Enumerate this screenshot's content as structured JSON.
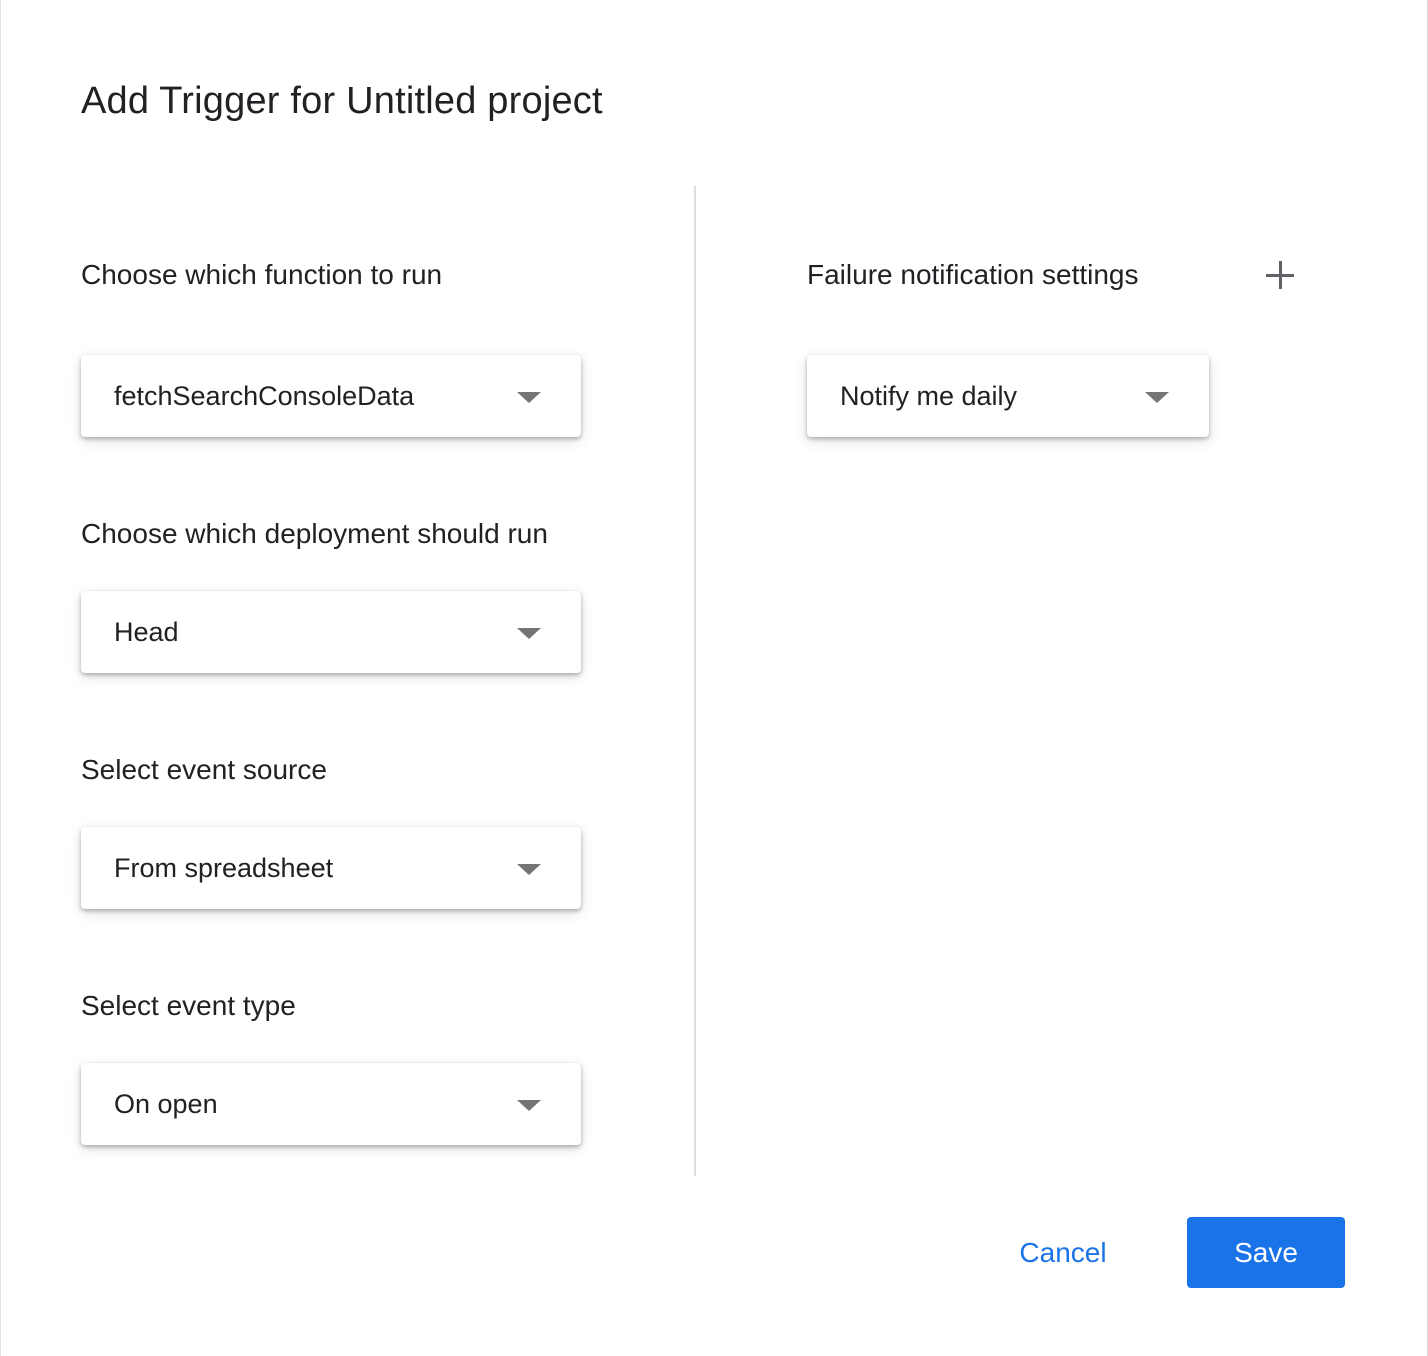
{
  "dialog": {
    "title": "Add Trigger for Untitled project"
  },
  "left_panel": {
    "function": {
      "label": "Choose which function to run",
      "selected": "fetchSearchConsoleData"
    },
    "deployment": {
      "label": "Choose which deployment should run",
      "selected": "Head"
    },
    "event_source": {
      "label": "Select event source",
      "selected": "From spreadsheet"
    },
    "event_type": {
      "label": "Select event type",
      "selected": "On open"
    }
  },
  "right_panel": {
    "failure_notification": {
      "label": "Failure notification settings",
      "selected": "Notify me daily",
      "add_icon": "plus-icon"
    }
  },
  "footer": {
    "cancel_label": "Cancel",
    "save_label": "Save"
  },
  "colors": {
    "accent": "#1a73e8",
    "text": "#202124",
    "divider": "#dadce0",
    "icon": "#5f6368"
  }
}
